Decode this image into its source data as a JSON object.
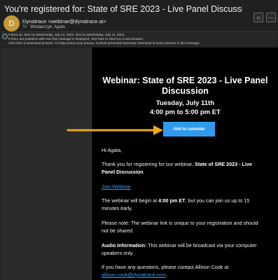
{
  "subject": "You're registered for: State of SRE 2023 - Live Panel Discussion - July 11th",
  "header": {
    "avatar_letter": "D",
    "sender": "Dynatrace <webinar@dynatrace.ai>",
    "to_label": "To",
    "to_value": "Wlodarczyk, Agata",
    "sun_icon": "☼",
    "ellipsis_icon": "⋯"
  },
  "infobar": {
    "icon": "i",
    "line1": "Follow up.  Start by Wednesday, July 12, 2023.  Due by Wednesday, July 12, 2023.",
    "line2": "If there are problems with how this message is displayed, click here to view it in a web browser.",
    "line3": "Click here to download pictures. To help protect your privacy, Outlook prevented automatic download of some pictures in this message."
  },
  "email": {
    "title": "Webinar: State of SRE 2023 - Live Panel Discussion",
    "date_line": "Tuesday, July 11th",
    "time_line": "4:00 pm to 5:00 pm ET",
    "add_to_calendar": "Add to calendar",
    "greeting": "Hi Agata,",
    "thanks_prefix": "Thank you for registering for our webinar, ",
    "thanks_bold": "State of SRE 2023 - Live Panel Discussion",
    "thanks_suffix": ".",
    "join_link": "Join Webinar",
    "begin_prefix": "The webinar will begin at ",
    "begin_bold": "4:00 pm ET",
    "begin_suffix": ", but you can join us up to 15 minutes early.",
    "note": "Please note: The webinar link is unique to your registration and should not be shared.",
    "audio_bold": "Audio Information:",
    "audio_text": " This webinar will be broadcast via your computer speakers only.",
    "questions": "If you have any questions, please contact Allison Cook at",
    "contact_email": "allison.cook@dynatrace.com",
    "contact_suffix": "."
  },
  "colors": {
    "button": "#2f9bef",
    "arrow": "#f0a81c",
    "avatar": "#c39a3a",
    "link": "#3a9cf0"
  }
}
